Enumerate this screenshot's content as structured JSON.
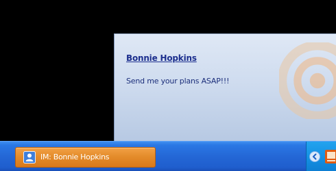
{
  "notification": {
    "sender": "Bonnie Hopkins",
    "message": "Send me your plans ASAP!!!"
  },
  "taskbar": {
    "active_task_label": "IM: Bonnie Hopkins",
    "task_icon": "messenger-icon",
    "tray_icons": [
      "show-hidden-icons-chevron",
      "tray-app-icon"
    ]
  },
  "colors": {
    "taskbar_blue": "#2467d6",
    "active_task_orange": "#e48c2b",
    "tray_blue": "#1592e4",
    "sender_text": "#1c2f8e"
  }
}
